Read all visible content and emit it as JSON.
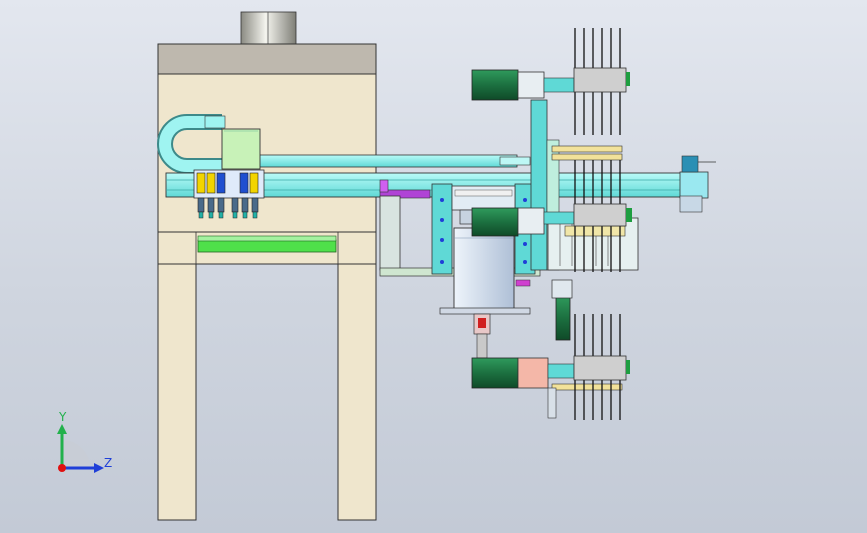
{
  "triad": {
    "y_label": "Y",
    "z_label": "Z",
    "y_color": "#22b14c",
    "z_color": "#1f3fd8",
    "x_color": "#e01010"
  },
  "palette": {
    "frame": "#efe6cd",
    "frame_top": "#beb8ae",
    "rail_cyan": "#8ff0ee",
    "motor_green": "#1e7a46",
    "panel_green": "#c8f2b8",
    "purple": "#b043d6",
    "box_blue": "#d5e2f2",
    "salmon": "#f4b7a8"
  }
}
